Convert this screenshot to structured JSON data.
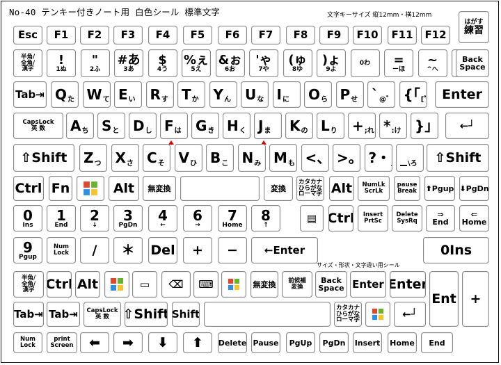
{
  "header": {
    "title": "No-40 テンキー付きノート用 白色シール 標準文字",
    "size_note": "文字キーサイズ 縦12mm・横12mm",
    "peelable_label": "はがす",
    "practice_label": "練習"
  },
  "subnote": "サイズ・形状・文字違い用シール",
  "accent_color": "#e00000",
  "rows": {
    "fn": [
      "Esc",
      "F1",
      "F2",
      "F3",
      "F4",
      "F5",
      "F6",
      "F7",
      "F8",
      "F9",
      "F10",
      "F11",
      "F12"
    ],
    "num": [
      {
        "main": "!",
        "sub": "1ぬ"
      },
      {
        "main": "\"",
        "sub": "2ふ"
      },
      {
        "main": "#あ",
        "sub": "3あ"
      },
      {
        "main": "$",
        "sub": "4う"
      },
      {
        "main": "%ぇ",
        "sub": "5え"
      },
      {
        "main": "&ぉ",
        "sub": "6お"
      },
      {
        "main": "'ゃ",
        "sub": "7や"
      },
      {
        "main": "(ゅ",
        "sub": "8ゆ"
      },
      {
        "main": ")ょ",
        "sub": "9よ"
      },
      {
        "main": "",
        "sub": "0わ"
      },
      {
        "main": "=",
        "sub": "ーほ"
      },
      {
        "main": "~",
        "sub": "^へ"
      },
      {
        "main": "|",
        "sub": "¥ー"
      }
    ],
    "hankaku": "半角/\n全角/\n漢字",
    "backspace": "Back\nSpace",
    "qwerty": [
      {
        "l": "Q",
        "s": "た"
      },
      {
        "l": "W",
        "s": "て"
      },
      {
        "l": "E",
        "s": "い"
      },
      {
        "l": "R",
        "s": "す"
      },
      {
        "l": "T",
        "s": "か"
      },
      {
        "l": "Y",
        "s": "ん"
      },
      {
        "l": "U",
        "s": "な"
      },
      {
        "l": "I",
        "s": "に"
      },
      {
        "l": "O",
        "s": "ら"
      },
      {
        "l": "P",
        "s": "せ"
      },
      {
        "l": "`",
        "s": "@゛"
      },
      {
        "l": "{「",
        "s": "[゜"
      }
    ],
    "tab": "Tab",
    "enter": "Enter",
    "capslock": "CapsLock\n英 数",
    "asdf": [
      {
        "l": "A",
        "s": "ち"
      },
      {
        "l": "S",
        "s": "と"
      },
      {
        "l": "D",
        "s": "し"
      },
      {
        "l": "F",
        "s": "は"
      },
      {
        "l": "G",
        "s": "き"
      },
      {
        "l": "H",
        "s": "く"
      },
      {
        "l": "J",
        "s": "ま"
      },
      {
        "l": "K",
        "s": "の"
      },
      {
        "l": "L",
        "s": "り"
      },
      {
        "l": "+",
        "s": ";れ"
      },
      {
        "l": "*",
        "s": ":け"
      },
      {
        "l": "}」",
        "s": "]む"
      }
    ],
    "shift": "⇧Shift",
    "zxcv": [
      {
        "l": "Z",
        "s": "つ"
      },
      {
        "l": "X",
        "s": "さ"
      },
      {
        "l": "C",
        "s": "そ"
      },
      {
        "l": "V",
        "s": "ひ"
      },
      {
        "l": "B",
        "s": "こ"
      },
      {
        "l": "N",
        "s": "み"
      },
      {
        "l": "M",
        "s": "も"
      },
      {
        "l": "<、",
        "s": ",ね"
      },
      {
        "l": ">。",
        "s": ".る"
      },
      {
        "l": "?・",
        "s": "/め"
      },
      {
        "l": "_",
        "s": "\\ろ"
      }
    ],
    "bottom": {
      "ctrl": "Ctrl",
      "fn": "Fn",
      "alt": "Alt",
      "muhenkan": "無変換",
      "henkan": "変換",
      "kana": "カタカナ\nひらがな\nローマ字",
      "alt_r": "Alt",
      "numlk": "NumLk\nScrLk",
      "pause": "pause\nBreak",
      "pgup": "Pgup",
      "pgdn": "PgDn"
    },
    "numpad1": [
      {
        "main": "0",
        "sub": "Ins"
      },
      {
        "main": "1",
        "sub": "End"
      },
      {
        "main": "2",
        "sub": "↓"
      },
      {
        "main": "3",
        "sub": "PgDn"
      },
      {
        "main": "4",
        "sub": "←"
      },
      {
        "main": "6",
        "sub": "→"
      },
      {
        "main": "7",
        "sub": "Home"
      },
      {
        "main": "8",
        "sub": "↑"
      }
    ],
    "ctrl2": "Ctrl",
    "insert": "Insert\nPrtSc",
    "delete": "Delete\nSysRq",
    "end": "End",
    "home": "Home",
    "numpad2": {
      "pgup": {
        "main": "9",
        "sub": "Pgup"
      },
      "numlock": "Num\nLock",
      "slash": "/",
      "star": "＊",
      "del": "Del",
      "plus": "+",
      "minus": "−",
      "enter": "Enter",
      "ins": "Ins",
      "zero": "0"
    }
  },
  "spares": {
    "row1": [
      "半角/\n全角/\n漢字",
      "Ctrl",
      "Alt",
      "",
      "",
      "",
      "",
      "",
      "無変換",
      "前候補\n変換",
      "Back\nSpace",
      "Enter",
      "Enter",
      "Ent",
      "+"
    ],
    "row2": [
      "Tab",
      "Tab",
      "CapsLock\n英 数",
      "⇧Shift",
      "Shift",
      "",
      "カタカナ\nひらがな\nローマ字",
      "",
      ""
    ],
    "row3": [
      "Num\nLock",
      "print\nScreen",
      "←",
      "→",
      "↓",
      "↑",
      "Delete",
      "Pause",
      "PgUp",
      "PgDn",
      "Insert",
      "Home",
      "End"
    ]
  }
}
